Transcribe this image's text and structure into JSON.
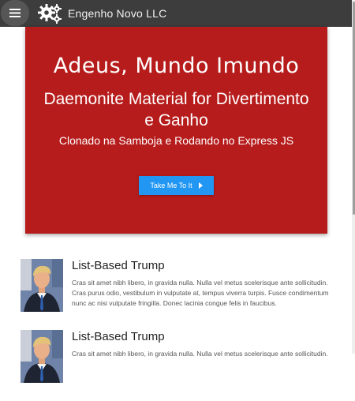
{
  "app": {
    "title": "Engenho Novo LLC"
  },
  "hero": {
    "title": "Adeus, Mundo Imundo",
    "subtitle": "Daemonite Material for Divertimento e Ganho",
    "tagline": "Clonado na Samboja e Rodando no Express JS",
    "button_label": "Take Me To It"
  },
  "items": [
    {
      "title": "List-Based Trump",
      "body": "Cras sit amet nibh libero, in gravida nulla. Nulla vel metus scelerisque ante sollicitudin. Cras purus odio, vestibulum in vulputate at, tempus viverra turpis. Fusce condimentum nunc ac nisi vulputate fringilla. Donec lacinia congue felis in faucibus."
    },
    {
      "title": "List-Based Trump",
      "body": "Cras sit amet nibh libero, in gravida nulla. Nulla vel metus scelerisque ante sollicitudin."
    }
  ],
  "colors": {
    "appbar": "#3d3d3d",
    "hero": "#b71c1c",
    "accent": "#2196f3"
  },
  "icons": [
    "menu-icon",
    "gears-logo-icon",
    "caret-right-icon"
  ]
}
